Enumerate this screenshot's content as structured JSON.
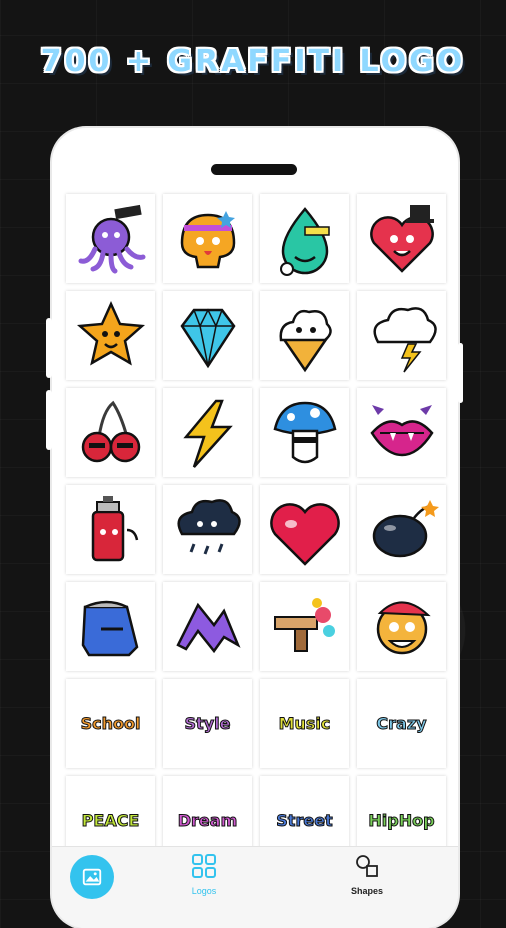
{
  "headline": "700 + GRAFFITI LOGO",
  "tiles": [
    {
      "name": "octopus-logo",
      "kind": "octopus",
      "label": ""
    },
    {
      "name": "orange-blob-logo",
      "kind": "blob",
      "label": ""
    },
    {
      "name": "water-drop-logo",
      "kind": "drop",
      "label": ""
    },
    {
      "name": "heart-hat-logo",
      "kind": "hearthat",
      "label": ""
    },
    {
      "name": "star-logo",
      "kind": "star",
      "label": ""
    },
    {
      "name": "diamond-logo",
      "kind": "diamond",
      "label": ""
    },
    {
      "name": "ice-cream-logo",
      "kind": "icecream",
      "label": ""
    },
    {
      "name": "cloud-lightning-logo",
      "kind": "cloudbolt",
      "label": ""
    },
    {
      "name": "cherries-logo",
      "kind": "cherries",
      "label": ""
    },
    {
      "name": "lightning-logo",
      "kind": "bolt",
      "label": ""
    },
    {
      "name": "mushroom-logo",
      "kind": "mushroom",
      "label": ""
    },
    {
      "name": "vampire-lips-logo",
      "kind": "lips",
      "label": ""
    },
    {
      "name": "spray-can-logo",
      "kind": "spray",
      "label": ""
    },
    {
      "name": "rain-cloud-logo",
      "kind": "raincloud",
      "label": ""
    },
    {
      "name": "red-heart-logo",
      "kind": "heart",
      "label": ""
    },
    {
      "name": "bomb-logo",
      "kind": "bomb",
      "label": ""
    },
    {
      "name": "blue-spray-cap-logo",
      "kind": "cap",
      "label": ""
    },
    {
      "name": "purple-arrow-logo",
      "kind": "arrow",
      "label": ""
    },
    {
      "name": "paint-gun-logo",
      "kind": "gun",
      "label": ""
    },
    {
      "name": "monkey-logo",
      "kind": "monkey",
      "label": ""
    },
    {
      "name": "school-word-logo",
      "kind": "word",
      "label": "School",
      "color": "#f29a2e"
    },
    {
      "name": "style-word-logo",
      "kind": "word",
      "label": "Style",
      "color": "#b06bd0"
    },
    {
      "name": "music-word-logo",
      "kind": "word",
      "label": "Music",
      "color": "#e0e03a"
    },
    {
      "name": "crazy-word-logo",
      "kind": "word",
      "label": "Crazy",
      "color": "#7ec8e8"
    },
    {
      "name": "peace-word-logo",
      "kind": "word",
      "label": "PEACE",
      "color": "#c3e83a"
    },
    {
      "name": "dream-dance-word-logo",
      "kind": "word",
      "label": "Dream",
      "color": "#d05ad0"
    },
    {
      "name": "street-word-logo",
      "kind": "word",
      "label": "Street",
      "color": "#4a7ad8"
    },
    {
      "name": "hiphop-word-logo",
      "kind": "word",
      "label": "HipHop",
      "color": "#7ad05a"
    }
  ],
  "nav": {
    "logos_label": "Logos",
    "shapes_label": "Shapes"
  },
  "colors": {
    "accent": "#33c3ee",
    "headline": "#8fd8ff"
  }
}
